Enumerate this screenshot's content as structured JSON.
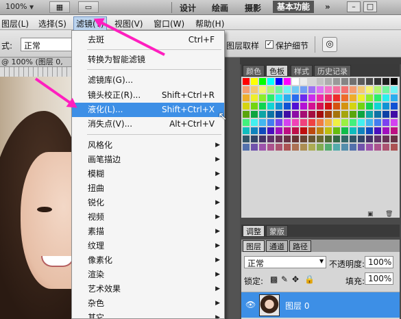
{
  "appbar": {
    "zoom": "100%",
    "workspaces": [
      "设计",
      "绘画",
      "摄影",
      "基本功能"
    ],
    "more": "»",
    "win_min": "–",
    "win_max": "□"
  },
  "menubar": {
    "items": [
      "图层(L)",
      "选择(S)",
      "滤镜(T)",
      "视图(V)",
      "窗口(W)",
      "帮助(H)"
    ]
  },
  "options": {
    "mode_label": "式:",
    "mode_value": "正常",
    "sample_layers": "图层取样",
    "protect_detail": "保护细节"
  },
  "document": {
    "tab": "@ 100% (图层 0, RG"
  },
  "filter_menu": {
    "items": [
      {
        "label": "去斑",
        "shortcut": "Ctrl+F"
      },
      {
        "label": "转换为智能滤镜",
        "shortcut": ""
      },
      {
        "label": "滤镜库(G)...",
        "shortcut": ""
      },
      {
        "label": "镜头校正(R)...",
        "shortcut": "Shift+Ctrl+R"
      },
      {
        "label": "液化(L)...",
        "shortcut": "Shift+Ctrl+X"
      },
      {
        "label": "消失点(V)...",
        "shortcut": "Alt+Ctrl+V"
      }
    ],
    "submenus": [
      "风格化",
      "画笔描边",
      "模糊",
      "扭曲",
      "锐化",
      "视频",
      "素描",
      "纹理",
      "像素化",
      "渲染",
      "艺术效果",
      "杂色",
      "其它"
    ]
  },
  "panels": {
    "swatch_tabs": [
      "颜色",
      "色板",
      "样式",
      "历史记录"
    ],
    "adjust_tabs": [
      "调整",
      "蒙版"
    ],
    "layer_tabs": [
      "图层",
      "通道",
      "路径"
    ],
    "blend_mode": "正常",
    "opacity_label": "不透明度:",
    "opacity_value": "100%",
    "lock_label": "锁定:",
    "fill_label": "填充:",
    "fill_value": "100%",
    "layer_name": "图层 0"
  },
  "colors": {
    "accent": "#3d8fe6",
    "annotation_arrow": "#ff1fbf"
  }
}
